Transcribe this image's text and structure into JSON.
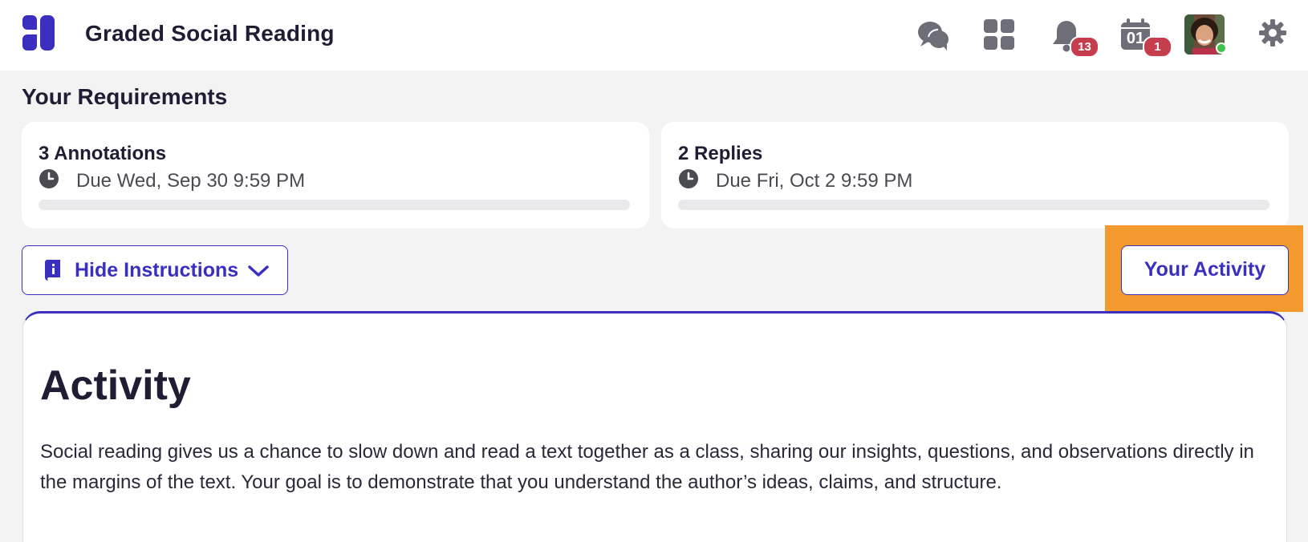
{
  "header": {
    "app_title": "Graded Social Reading",
    "icons": [
      "logo-icon",
      "chat-bubbles-icon",
      "apps-grid-icon",
      "bell-icon",
      "calendar-icon",
      "avatar",
      "gear-icon"
    ],
    "notification_count": "13",
    "calendar_day": "01",
    "calendar_count": "1"
  },
  "requirements": {
    "heading": "Your Requirements",
    "items": [
      {
        "title": "3 Annotations",
        "due": "Due Wed, Sep 30 9:59 PM",
        "progress": 0
      },
      {
        "title": "2 Replies",
        "due": "Due Fri, Oct 2 9:59 PM",
        "progress": 0
      }
    ]
  },
  "actions": {
    "hide_instructions_label": "Hide Instructions",
    "your_activity_label": "Your Activity"
  },
  "activity": {
    "title": "Activity",
    "body": "Social reading gives us a chance to slow down and read a text together as a class, sharing our insights, questions, and observations directly in the margins of the text. Your goal is to demonstrate that you understand the author’s ideas, claims, and structure."
  },
  "colors": {
    "accent": "#3b2fc0",
    "badge": "#c63e4e",
    "highlight": "#f29a2e",
    "online": "#3ec24a",
    "icon_gray": "#6e6e78"
  }
}
